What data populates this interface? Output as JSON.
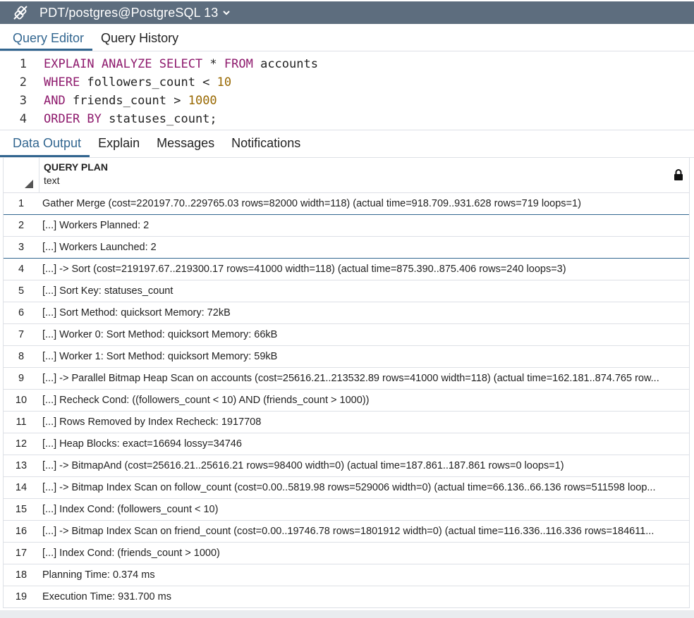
{
  "titlebar": {
    "connection": "PDT/postgres@PostgreSQL 13",
    "icon": "connection-plug-icon"
  },
  "editor_tabs": [
    {
      "label": "Query Editor",
      "active": true
    },
    {
      "label": "Query History",
      "active": false
    }
  ],
  "editor": {
    "lines": [
      {
        "num": "1",
        "tokens": [
          {
            "t": "EXPLAIN ANALYZE SELECT",
            "c": "kw"
          },
          {
            "t": " * ",
            "c": "plain"
          },
          {
            "t": "FROM",
            "c": "kw"
          },
          {
            "t": " accounts",
            "c": "plain"
          }
        ]
      },
      {
        "num": "2",
        "tokens": [
          {
            "t": "WHERE",
            "c": "kw"
          },
          {
            "t": " followers_count < ",
            "c": "plain"
          },
          {
            "t": "10",
            "c": "num"
          }
        ]
      },
      {
        "num": "3",
        "tokens": [
          {
            "t": "AND",
            "c": "kw"
          },
          {
            "t": " friends_count > ",
            "c": "plain"
          },
          {
            "t": "1000",
            "c": "num"
          }
        ]
      },
      {
        "num": "4",
        "tokens": [
          {
            "t": "ORDER BY",
            "c": "kw"
          },
          {
            "t": " statuses_count;",
            "c": "plain"
          }
        ]
      }
    ]
  },
  "output_tabs": [
    {
      "label": "Data Output",
      "active": true
    },
    {
      "label": "Explain",
      "active": false
    },
    {
      "label": "Messages",
      "active": false
    },
    {
      "label": "Notifications",
      "active": false
    }
  ],
  "grid": {
    "column": {
      "name": "QUERY PLAN",
      "type": "text"
    },
    "rows": [
      {
        "n": "1",
        "text": "Gather Merge  (cost=220197.70..229765.03 rows=82000 width=118) (actual time=918.709..931.628 rows=719 loops=1)"
      },
      {
        "n": "2",
        "text": "[...] Workers Planned: 2"
      },
      {
        "n": "3",
        "text": "[...] Workers Launched: 2"
      },
      {
        "n": "4",
        "text": "[...] ->  Sort  (cost=219197.67..219300.17 rows=41000 width=118) (actual time=875.390..875.406 rows=240 loops=3)"
      },
      {
        "n": "5",
        "text": "[...] Sort Key: statuses_count"
      },
      {
        "n": "6",
        "text": "[...] Sort Method: quicksort  Memory: 72kB"
      },
      {
        "n": "7",
        "text": "[...] Worker 0:  Sort Method: quicksort  Memory: 66kB"
      },
      {
        "n": "8",
        "text": "[...] Worker 1:  Sort Method: quicksort  Memory: 59kB"
      },
      {
        "n": "9",
        "text": "[...] ->  Parallel Bitmap Heap Scan on accounts  (cost=25616.21..213532.89 rows=41000 width=118) (actual time=162.181..874.765 row..."
      },
      {
        "n": "10",
        "text": "[...] Recheck Cond: ((followers_count < 10) AND (friends_count > 1000))"
      },
      {
        "n": "11",
        "text": "[...] Rows Removed by Index Recheck: 1917708"
      },
      {
        "n": "12",
        "text": "[...] Heap Blocks: exact=16694 lossy=34746"
      },
      {
        "n": "13",
        "text": "[...] ->  BitmapAnd  (cost=25616.21..25616.21 rows=98400 width=0) (actual time=187.861..187.861 rows=0 loops=1)"
      },
      {
        "n": "14",
        "text": "[...] ->  Bitmap Index Scan on follow_count  (cost=0.00..5819.98 rows=529006 width=0) (actual time=66.136..66.136 rows=511598 loop..."
      },
      {
        "n": "15",
        "text": "[...] Index Cond: (followers_count < 10)"
      },
      {
        "n": "16",
        "text": "[...] ->  Bitmap Index Scan on friend_count  (cost=0.00..19746.78 rows=1801912 width=0) (actual time=116.336..116.336 rows=184611..."
      },
      {
        "n": "17",
        "text": "[...] Index Cond: (friends_count > 1000)"
      },
      {
        "n": "18",
        "text": "Planning Time: 0.374 ms"
      },
      {
        "n": "19",
        "text": "Execution Time: 931.700 ms"
      }
    ]
  }
}
